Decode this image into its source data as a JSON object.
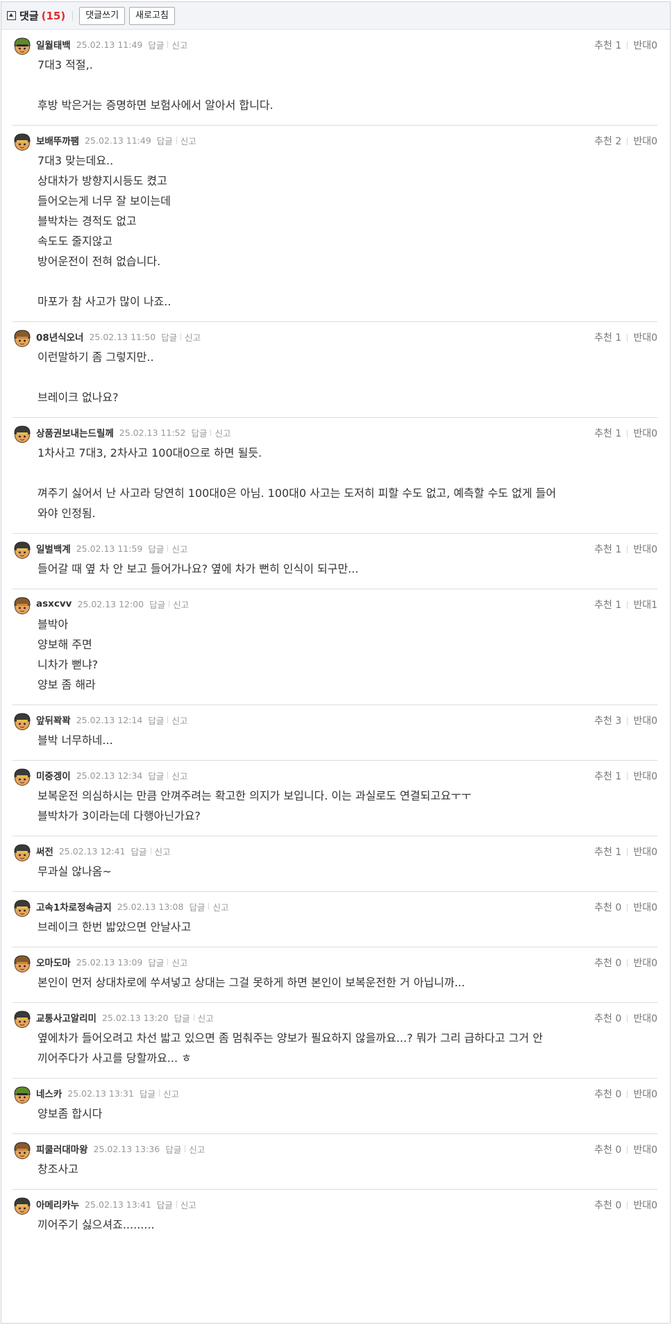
{
  "header": {
    "title": "댓글",
    "count": "(15)",
    "write_button": "댓글쓰기",
    "refresh_button": "새로고침"
  },
  "labels": {
    "reply": "답글",
    "report": "신고",
    "up": "추천",
    "down": "반대"
  },
  "comments": [
    {
      "nick": "일월태백",
      "date": "25.02.13 11:49",
      "up": "1",
      "down": "0",
      "text": "7대3 적절,.\n\n후방 박은거는 증명하면 보험사에서 알아서 합니다.",
      "avatar": {
        "helmet": "#5f8a2c",
        "visor": "#2a2a2a",
        "face": "#e7a45e"
      }
    },
    {
      "nick": "보배뚜까팸",
      "date": "25.02.13 11:49",
      "up": "2",
      "down": "0",
      "text": "7대3 맞는데요..\n상대차가 방향지시등도 켰고\n들어오는게 너무 잘 보이는데\n블박차는 경적도 없고\n속도도 줄지않고\n방어운전이 전혀 없습니다.\n\n마포가 참 사고가 많이 나죠..",
      "avatar": {
        "helmet": "#3a3a3a",
        "visor": "#e2c24a",
        "face": "#e7a45e"
      }
    },
    {
      "nick": "08년식오너",
      "date": "25.02.13 11:50",
      "up": "1",
      "down": "0",
      "text": "이런말하기 좀 그렇지만..\n\n브레이크 없나요?",
      "avatar": {
        "helmet": "#8a5a2b",
        "visor": "#c98c3c",
        "face": "#e7a45e"
      }
    },
    {
      "nick": "상품권보내는드릴께",
      "date": "25.02.13 11:52",
      "up": "1",
      "down": "0",
      "text": "1차사고 7대3, 2차사고 100대0으로 하면 될듯.\n\n껴주기 싫어서 난 사고라 당연히 100대0은 아님. 100대0 사고는 도저히 피할 수도 없고, 예측할 수도 없게 들어\n와야 인정됨.",
      "avatar": {
        "helmet": "#3a3a3a",
        "visor": "#e2c24a",
        "face": "#e7a45e"
      }
    },
    {
      "nick": "일벌백계",
      "date": "25.02.13 11:59",
      "up": "1",
      "down": "0",
      "text": "들어갈 때 옆 차 안 보고 들어가나요? 옆에 차가 뻔히 인식이 되구만...",
      "avatar": {
        "helmet": "#3a3a3a",
        "visor": "#e2c24a",
        "face": "#e7a45e"
      }
    },
    {
      "nick": "asxcvv",
      "date": "25.02.13 12:00",
      "up": "1",
      "down": "1",
      "text": "블박아\n양보해 주면\n니차가 뻗냐?\n양보 좀 해라",
      "avatar": {
        "helmet": "#8a5a2b",
        "visor": "#c98c3c",
        "face": "#e7a45e"
      }
    },
    {
      "nick": "앞뒤꽉꽉",
      "date": "25.02.13 12:14",
      "up": "3",
      "down": "0",
      "text": "블박 너무하네...",
      "avatar": {
        "helmet": "#3a3a3a",
        "visor": "#e2c24a",
        "face": "#e7a45e"
      }
    },
    {
      "nick": "미중겡이",
      "date": "25.02.13 12:34",
      "up": "1",
      "down": "0",
      "text": "보복운전 의심하시는 만큼 안껴주려는 확고한 의지가 보입니다. 이는 과실로도 연결되고요ㅜㅜ\n블박차가 3이라는데 다행아닌가요?",
      "avatar": {
        "helmet": "#3a3a3a",
        "visor": "#e2c24a",
        "face": "#e7a45e"
      }
    },
    {
      "nick": "써전",
      "date": "25.02.13 12:41",
      "up": "1",
      "down": "0",
      "text": "무과실 않나옴~",
      "avatar": {
        "helmet": "#3a3a3a",
        "visor": "#e2c24a",
        "face": "#e7a45e"
      }
    },
    {
      "nick": "고속1차로정속금지",
      "date": "25.02.13 13:08",
      "up": "0",
      "down": "0",
      "text": "브레이크 한번 밟았으면 안날사고",
      "avatar": {
        "helmet": "#3a3a3a",
        "visor": "#e2c24a",
        "face": "#e7a45e"
      }
    },
    {
      "nick": "오마도마",
      "date": "25.02.13 13:09",
      "up": "0",
      "down": "0",
      "text": "본인이 먼저 상대차로에 쑤셔넣고 상대는 그걸 못하게 하면 본인이 보복운전한 거 아닙니까...",
      "avatar": {
        "helmet": "#8a5a2b",
        "visor": "#c98c3c",
        "face": "#e7a45e"
      }
    },
    {
      "nick": "교통사고알리미",
      "date": "25.02.13 13:20",
      "up": "0",
      "down": "0",
      "text": "옆에차가 들어오려고 차선 밟고 있으면 좀 멈춰주는 양보가 필요하지 않을까요...? 뭐가 그리 급하다고 그거 안\n끼어주다가 사고를 당할까요... ㅎ",
      "avatar": {
        "helmet": "#3a3a3a",
        "visor": "#e2c24a",
        "face": "#e7a45e"
      }
    },
    {
      "nick": "네스카",
      "date": "25.02.13 13:31",
      "up": "0",
      "down": "0",
      "text": "양보좀 합시다",
      "avatar": {
        "helmet": "#5f8a2c",
        "visor": "#2a2a2a",
        "face": "#e7a45e"
      }
    },
    {
      "nick": "피쿨러대마왕",
      "date": "25.02.13 13:36",
      "up": "0",
      "down": "0",
      "text": "창조사고",
      "avatar": {
        "helmet": "#8a5a2b",
        "visor": "#c98c3c",
        "face": "#e7a45e"
      }
    },
    {
      "nick": "아메리카누",
      "date": "25.02.13 13:41",
      "up": "0",
      "down": "0",
      "text": "끼어주기 싫으셔죠.........",
      "avatar": {
        "helmet": "#3a3a3a",
        "visor": "#e2c24a",
        "face": "#e7a45e"
      }
    }
  ]
}
